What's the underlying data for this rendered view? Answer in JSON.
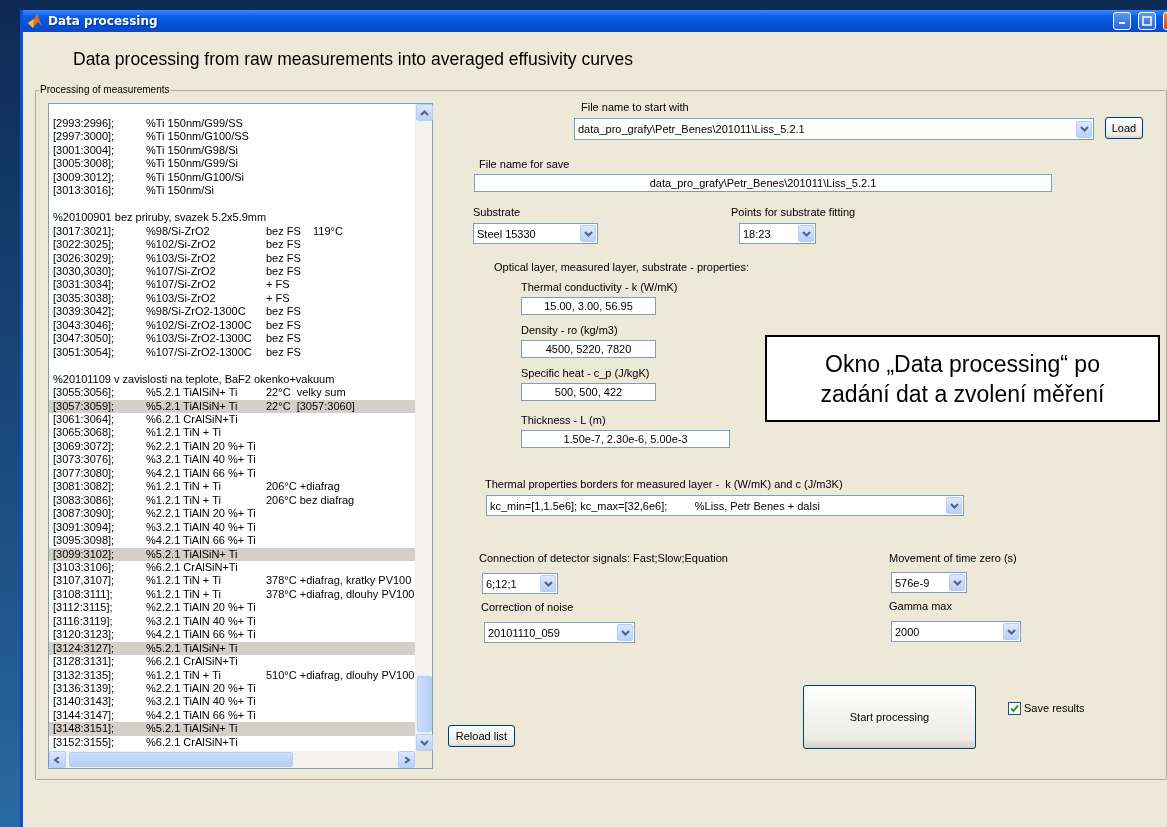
{
  "window": {
    "title": "Data processing"
  },
  "heading": "Data processing from raw measurements into averaged effusivity curves",
  "group": {
    "title": "Processing of measurements"
  },
  "list": {
    "rows": [
      {
        "kind": "entry",
        "range": "[2993:2996];",
        "sample": "%Ti 150nm/G99/SS",
        "selected": false
      },
      {
        "kind": "entry",
        "range": "[2997:3000];",
        "sample": "%Ti 150nm/G100/SS",
        "selected": false
      },
      {
        "kind": "entry",
        "range": "[3001:3004];",
        "sample": "%Ti 150nm/G98/Si",
        "selected": false
      },
      {
        "kind": "entry",
        "range": "[3005:3008];",
        "sample": "%Ti 150nm/G99/Si",
        "selected": false
      },
      {
        "kind": "entry",
        "range": "[3009:3012];",
        "sample": "%Ti 150nm/G100/Si",
        "selected": false
      },
      {
        "kind": "entry",
        "range": "[3013:3016];",
        "sample": "%Ti 150nm/Si",
        "selected": false
      },
      {
        "kind": "blank"
      },
      {
        "kind": "header",
        "text": "%20100901 bez priruby, svazek 5.2x5.9mm"
      },
      {
        "kind": "entry",
        "range": "[3017:3021];",
        "sample": "%98/Si-ZrO2",
        "note": "bez FS    119°C",
        "selected": false
      },
      {
        "kind": "entry",
        "range": "[3022:3025];",
        "sample": "%102/Si-ZrO2",
        "note": "bez FS",
        "selected": false
      },
      {
        "kind": "entry",
        "range": "[3026:3029];",
        "sample": "%103/Si-ZrO2",
        "note": "bez FS",
        "selected": false
      },
      {
        "kind": "entry",
        "range": "[3030,3030];",
        "sample": "%107/Si-ZrO2",
        "note": "bez FS",
        "selected": false
      },
      {
        "kind": "entry",
        "range": "[3031:3034];",
        "sample": "%107/Si-ZrO2",
        "note": "+ FS",
        "selected": false
      },
      {
        "kind": "entry",
        "range": "[3035:3038];",
        "sample": "%103/Si-ZrO2",
        "note": "+ FS",
        "selected": false
      },
      {
        "kind": "entry",
        "range": "[3039:3042];",
        "sample": "%98/Si-ZrO2-1300C",
        "note": "bez FS",
        "selected": false
      },
      {
        "kind": "entry",
        "range": "[3043:3046];",
        "sample": "%102/Si-ZrO2-1300C",
        "note": "bez FS",
        "selected": false
      },
      {
        "kind": "entry",
        "range": "[3047:3050];",
        "sample": "%103/Si-ZrO2-1300C",
        "note": "bez FS",
        "selected": false
      },
      {
        "kind": "entry",
        "range": "[3051:3054];",
        "sample": "%107/Si-ZrO2-1300C",
        "note": "bez FS",
        "selected": false
      },
      {
        "kind": "blank"
      },
      {
        "kind": "header",
        "text": "%20101109 v zavislosti na teplote, BaF2 okenko+vakuum"
      },
      {
        "kind": "entry",
        "range": "[3055:3056];",
        "sample": "%5.2.1 TiAlSiN+ Ti",
        "note": "22°C  velky sum",
        "selected": false
      },
      {
        "kind": "entry",
        "range": "[3057:3059];",
        "sample": "%5.2.1 TiAlSiN+ Ti",
        "note": "22°C  [3057:3060]",
        "selected": true
      },
      {
        "kind": "entry",
        "range": "[3061:3064];",
        "sample": "%6.2.1 CrAlSiN+Ti",
        "selected": false
      },
      {
        "kind": "entry",
        "range": "[3065:3068];",
        "sample": "%1.2.1 TiN + Ti",
        "selected": false
      },
      {
        "kind": "entry",
        "range": "[3069:3072];",
        "sample": "%2.2.1 TiAlN 20 %+ Ti",
        "selected": false
      },
      {
        "kind": "entry",
        "range": "[3073:3076];",
        "sample": "%3.2.1 TiAlN 40 %+ Ti",
        "selected": false
      },
      {
        "kind": "entry",
        "range": "[3077:3080];",
        "sample": "%4.2.1 TiAlN 66 %+ Ti",
        "selected": false
      },
      {
        "kind": "entry",
        "range": "[3081:3082];",
        "sample": "%1.2.1 TiN + Ti",
        "note": "206°C +diafrag",
        "selected": false
      },
      {
        "kind": "entry",
        "range": "[3083:3086];",
        "sample": "%1.2.1 TiN + Ti",
        "note": "206°C bez diafrag",
        "selected": false
      },
      {
        "kind": "entry",
        "range": "[3087:3090];",
        "sample": "%2.2.1 TiAlN 20 %+ Ti",
        "selected": false
      },
      {
        "kind": "entry",
        "range": "[3091:3094];",
        "sample": "%3.2.1 TiAlN 40 %+ Ti",
        "selected": false
      },
      {
        "kind": "entry",
        "range": "[3095:3098];",
        "sample": "%4.2.1 TiAlN 66 %+ Ti",
        "selected": false
      },
      {
        "kind": "entry",
        "range": "[3099:3102];",
        "sample": "%5.2.1 TiAlSiN+ Ti",
        "selected": true
      },
      {
        "kind": "entry",
        "range": "[3103:3106];",
        "sample": "%6.2.1 CrAlSiN+Ti",
        "selected": false
      },
      {
        "kind": "entry",
        "range": "[3107,3107];",
        "sample": "%1.2.1 TiN + Ti",
        "note": "378°C +diafrag, kratky PV100",
        "selected": false
      },
      {
        "kind": "entry",
        "range": "[3108:3111];",
        "sample": "%1.2.1 TiN + Ti",
        "note": "378°C +diafrag, dlouhy PV100",
        "selected": false
      },
      {
        "kind": "entry",
        "range": "[3112:3115];",
        "sample": "%2.2.1 TiAlN 20 %+ Ti",
        "selected": false
      },
      {
        "kind": "entry",
        "range": "[3116:3119];",
        "sample": "%3.2.1 TiAlN 40 %+ Ti",
        "selected": false
      },
      {
        "kind": "entry",
        "range": "[3120:3123];",
        "sample": "%4.2.1 TiAlN 66 %+ Ti",
        "selected": false
      },
      {
        "kind": "entry",
        "range": "[3124:3127];",
        "sample": "%5.2.1 TiAlSiN+ Ti",
        "selected": true
      },
      {
        "kind": "entry",
        "range": "[3128:3131];",
        "sample": "%6.2.1 CrAlSiN+Ti",
        "selected": false
      },
      {
        "kind": "entry",
        "range": "[3132:3135];",
        "sample": "%1.2.1 TiN + Ti",
        "note": "510°C +diafrag, dlouhy PV100",
        "selected": false
      },
      {
        "kind": "entry",
        "range": "[3136:3139];",
        "sample": "%2.2.1 TiAlN 20 %+ Ti",
        "selected": false
      },
      {
        "kind": "entry",
        "range": "[3140:3143];",
        "sample": "%3.2.1 TiAlN 40 %+ Ti",
        "selected": false
      },
      {
        "kind": "entry",
        "range": "[3144:3147];",
        "sample": "%4.2.1 TiAlN 66 %+ Ti",
        "selected": false
      },
      {
        "kind": "entry",
        "range": "[3148:3151];",
        "sample": "%5.2.1 TiAlSiN+ Ti",
        "selected": true
      },
      {
        "kind": "entry",
        "range": "[3152:3155];",
        "sample": "%6.2.1 CrAlSiN+Ti",
        "selected": false
      }
    ]
  },
  "reload_button": "Reload list",
  "start_file": {
    "label": "File name to start with",
    "value": "data_pro_grafy\\Petr_Benes\\201011\\Liss_5.2.1"
  },
  "load_button": "Load",
  "save_file": {
    "label": "File name for save",
    "value": "data_pro_grafy\\Petr_Benes\\201011\\Liss_5.2.1"
  },
  "substrate": {
    "label": "Substrate",
    "value": "Steel 15330"
  },
  "fit_points": {
    "label": "Points for substrate fitting",
    "value": "18:23"
  },
  "properties": {
    "title": "Optical layer, measured layer, substrate - properties:",
    "fields": [
      {
        "label": "Thermal conductivity - k (W/mK)",
        "value": "15.00, 3.00, 56.95"
      },
      {
        "label": "Density - ro (kg/m3)",
        "value": "4500, 5220, 7820"
      },
      {
        "label": "Specific heat - c_p (J/kgK)",
        "value": "500, 500, 422"
      },
      {
        "label": "Thickness - L (m)",
        "value": "1.50e-7, 2.30e-6, 5.00e-3"
      }
    ]
  },
  "borders": {
    "label": "Thermal properties borders for measured layer -  k (W/mK) and c (J/m3K)",
    "value": "kc_min=[1,1.5e6]; kc_max=[32,6e6];         %Liss, Petr Benes + dalsi"
  },
  "connection": {
    "label": "Connection of detector signals: Fast;Slow;Equation",
    "value": "6;12;1"
  },
  "time_zero": {
    "label": "Movement of time zero (s)",
    "value": "576e-9"
  },
  "noise": {
    "label": "Correction of noise",
    "value": "20101110_059"
  },
  "gamma": {
    "label": "Gamma max",
    "value": "2000"
  },
  "start_button": "Start processing",
  "save_results": {
    "label": "Save results",
    "checked": true
  },
  "annotation": "Okno „Data processing“ po zadání dat a zvolení měření"
}
